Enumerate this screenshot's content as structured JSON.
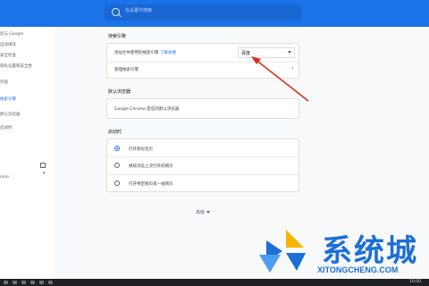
{
  "search": {
    "placeholder": "在设置中搜索",
    "icon": "search-icon"
  },
  "sidebar": {
    "items": [
      {
        "label": "您与 Google",
        "active": false
      },
      {
        "label": "自动填充",
        "active": false
      },
      {
        "label": "安全检查",
        "active": false
      },
      {
        "label": "隐私设置和安全性",
        "active": false
      },
      {
        "label": "外观",
        "active": false
      },
      {
        "label": "搜索引擎",
        "active": true
      },
      {
        "label": "默认浏览器",
        "active": false
      },
      {
        "label": "启动时",
        "active": false
      }
    ],
    "extensions_label": "ome"
  },
  "search_engine": {
    "section_title": "搜索引擎",
    "address_bar_label": "地址栏中使用的搜索引擎",
    "learn_more": "了解详情",
    "selected_engine": "百度",
    "manage_label": "管理搜索引擎"
  },
  "default_browser": {
    "section_title": "默认浏览器",
    "status": "Google Chrome 是您的默认浏览器"
  },
  "on_startup": {
    "section_title": "启动时",
    "options": [
      {
        "label": "打开新标签页",
        "checked": true
      },
      {
        "label": "继续浏览上次打开的网页",
        "checked": false
      },
      {
        "label": "打开特定网页或一组网页",
        "checked": false
      }
    ]
  },
  "advanced": {
    "label": "高级"
  },
  "watermark": {
    "title": "系统城",
    "url": "XITONGCHENG.COM"
  },
  "taskbar": {
    "time": "10:00"
  },
  "colors": {
    "accent": "#1a73e8",
    "arrow": "#d93025",
    "watermark": "#1c6fd6"
  }
}
